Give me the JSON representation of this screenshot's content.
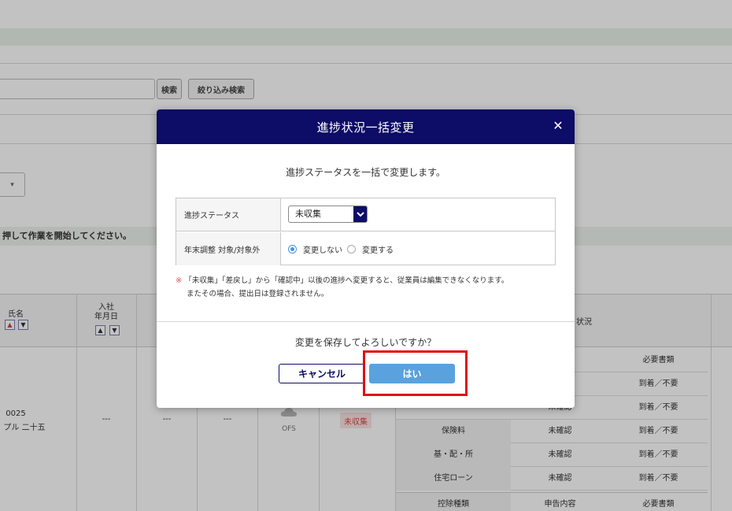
{
  "background": {
    "search": {
      "search_button": "検索",
      "filter_button": "絞り込み検索"
    },
    "notice": "押して作業を開始してください。",
    "table": {
      "col_name": "氏名",
      "col_hire": "入社\n年月日",
      "col_status_partial": "状況",
      "row": {
        "id": "0025",
        "name": "プル 二十五",
        "dash1": "---",
        "dash2": "---",
        "dash3": "---",
        "ofs_label": "OFS",
        "badge": "未収集"
      },
      "subtable": {
        "header_col3": "必要書類",
        "rows": [
          {
            "c1": "",
            "c2": "",
            "c3": "到着／不要"
          },
          {
            "c1": "",
            "c2": "未確認",
            "c3": "到着／不要"
          },
          {
            "c1": "保険料",
            "c2": "未確認",
            "c3": "到着／不要"
          },
          {
            "c1": "基・配・所",
            "c2": "未確認",
            "c3": "到着／不要"
          },
          {
            "c1": "住宅ローン",
            "c2": "未確認",
            "c3": "到着／不要"
          },
          {
            "c1": "控除種類",
            "c2": "申告内容",
            "c3": "必要書類"
          }
        ]
      }
    }
  },
  "modal": {
    "title": "進捗状況一括変更",
    "lead": "進捗ステータスを一括で変更します。",
    "status_label": "進捗ステータス",
    "status_value": "未収集",
    "year_end_label": "年末調整 対象/対象外",
    "radio_no_change": "変更しない",
    "radio_change": "変更する",
    "warning_line1": "「未収集」「差戻し」から「確認中」以後の進捗へ変更すると、従業員は編集できなくなります。",
    "warning_line2": "またその場合、提出日は登録されません。",
    "warning_mark": "※",
    "confirm": "変更を保存してよろしいですか？",
    "cancel_button": "キャンセル",
    "yes_button": "はい"
  },
  "colors": {
    "header": "#0d0c66",
    "primary_button": "#5aa2dd",
    "highlight": "#e01010"
  }
}
